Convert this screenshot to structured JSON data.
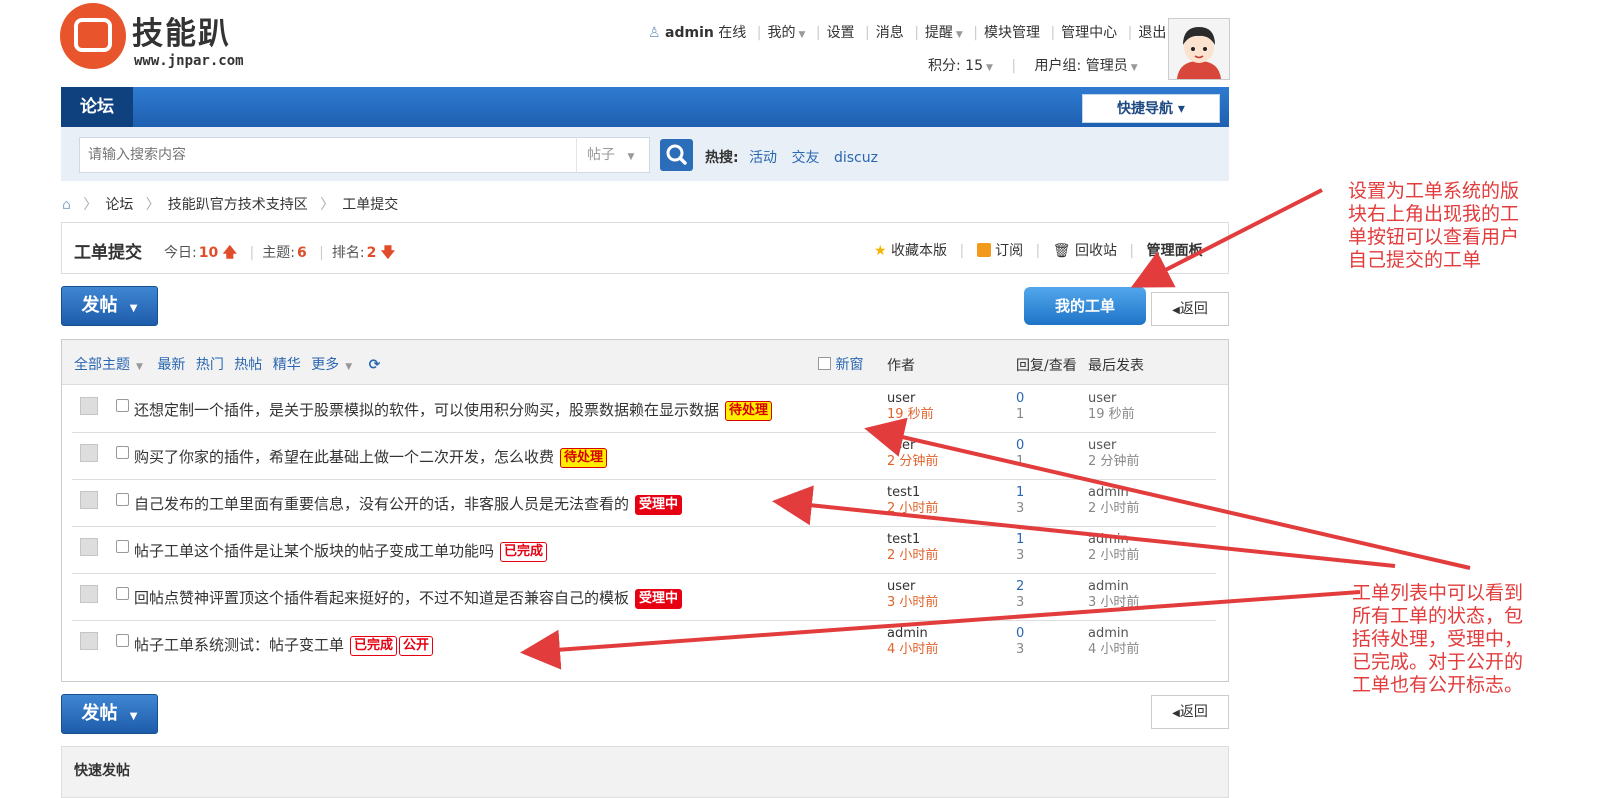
{
  "logo": {
    "name": "技能趴",
    "url": "www.jnpar.com"
  },
  "userbar": {
    "username": "admin",
    "online": "在线",
    "items": [
      "我的",
      "设置",
      "消息",
      "提醒",
      "模块管理",
      "管理中心",
      "退出"
    ],
    "points_label": "积分: 15",
    "usergroup_label": "用户组: 管理员"
  },
  "nav": {
    "forum": "论坛",
    "quick_nav": "快捷导航 ▾"
  },
  "search": {
    "placeholder": "请输入搜索内容",
    "type": "帖子",
    "hot_label": "热搜:",
    "hot": [
      "活动",
      "交友",
      "discuz"
    ]
  },
  "breadcrumb": [
    "论坛",
    "技能趴官方技术支持区",
    "工单提交"
  ],
  "forum": {
    "title": "工单提交",
    "today_label": "今日:",
    "today": "10",
    "topics_label": "主题:",
    "topics": "6",
    "rank_label": "排名:",
    "rank": "2",
    "actions": {
      "favorite": "收藏本版",
      "subscribe": "订阅",
      "recycle": "回收站",
      "manage": "管理面板"
    }
  },
  "buttons": {
    "post": "发帖",
    "my_orders": "我的工单",
    "back": "返回"
  },
  "filters": {
    "items": [
      "全部主题",
      "最新",
      "热门",
      "热帖",
      "精华",
      "更多"
    ],
    "new_window": "新窗"
  },
  "columns": {
    "author": "作者",
    "reply_view": "回复/查看",
    "last_post": "最后发表"
  },
  "threads": [
    {
      "title": "还想定制一个插件，是关于股票模拟的软件，可以使用积分购买，股票数据赖在显示数据",
      "status": "待处理",
      "public": "",
      "author": "user",
      "author_time": "19 秒前",
      "replies": "0",
      "views": "1",
      "last_user": "user",
      "last_time": "19 秒前"
    },
    {
      "title": "购买了你家的插件，希望在此基础上做一个二次开发，怎么收费",
      "status": "待处理",
      "public": "",
      "author": "user",
      "author_time": "2 分钟前",
      "replies": "0",
      "views": "1",
      "last_user": "user",
      "last_time": "2 分钟前"
    },
    {
      "title": "自己发布的工单里面有重要信息，没有公开的话，非客服人员是无法查看的",
      "status": "受理中",
      "public": "",
      "author": "test1",
      "author_time": "2 小时前",
      "replies": "1",
      "views": "3",
      "last_user": "admin",
      "last_time": "2 小时前"
    },
    {
      "title": "帖子工单这个插件是让某个版块的帖子变成工单功能吗",
      "status": "已完成",
      "public": "",
      "author": "test1",
      "author_time": "2 小时前",
      "replies": "1",
      "views": "3",
      "last_user": "admin",
      "last_time": "2 小时前"
    },
    {
      "title": "回帖点赞神评置顶这个插件看起来挺好的，不过不知道是否兼容自己的模板",
      "status": "受理中",
      "public": "",
      "author": "user",
      "author_time": "3 小时前",
      "replies": "2",
      "views": "3",
      "last_user": "admin",
      "last_time": "3 小时前"
    },
    {
      "title": "帖子工单系统测试：帖子变工单",
      "status": "已完成",
      "public": "公开",
      "author": "admin",
      "author_time": "4 小时前",
      "replies": "0",
      "views": "3",
      "last_user": "admin",
      "last_time": "4 小时前"
    }
  ],
  "quick_post": "快速发帖",
  "annotations": {
    "note1": [
      "设置为工单系统的版",
      "块右上角出现我的工",
      "单按钮可以查看用户",
      "自己提交的工单"
    ],
    "note2": [
      "工单列表中可以看到",
      "所有工单的状态，包",
      "括待处理，受理中，",
      "已完成。对于公开的",
      "工单也有公开标志。"
    ]
  },
  "colors": {
    "accent": "#1e5fb0",
    "annotation": "#e23c3c",
    "status_red": "#e60012",
    "status_yellow": "#ffee00"
  }
}
